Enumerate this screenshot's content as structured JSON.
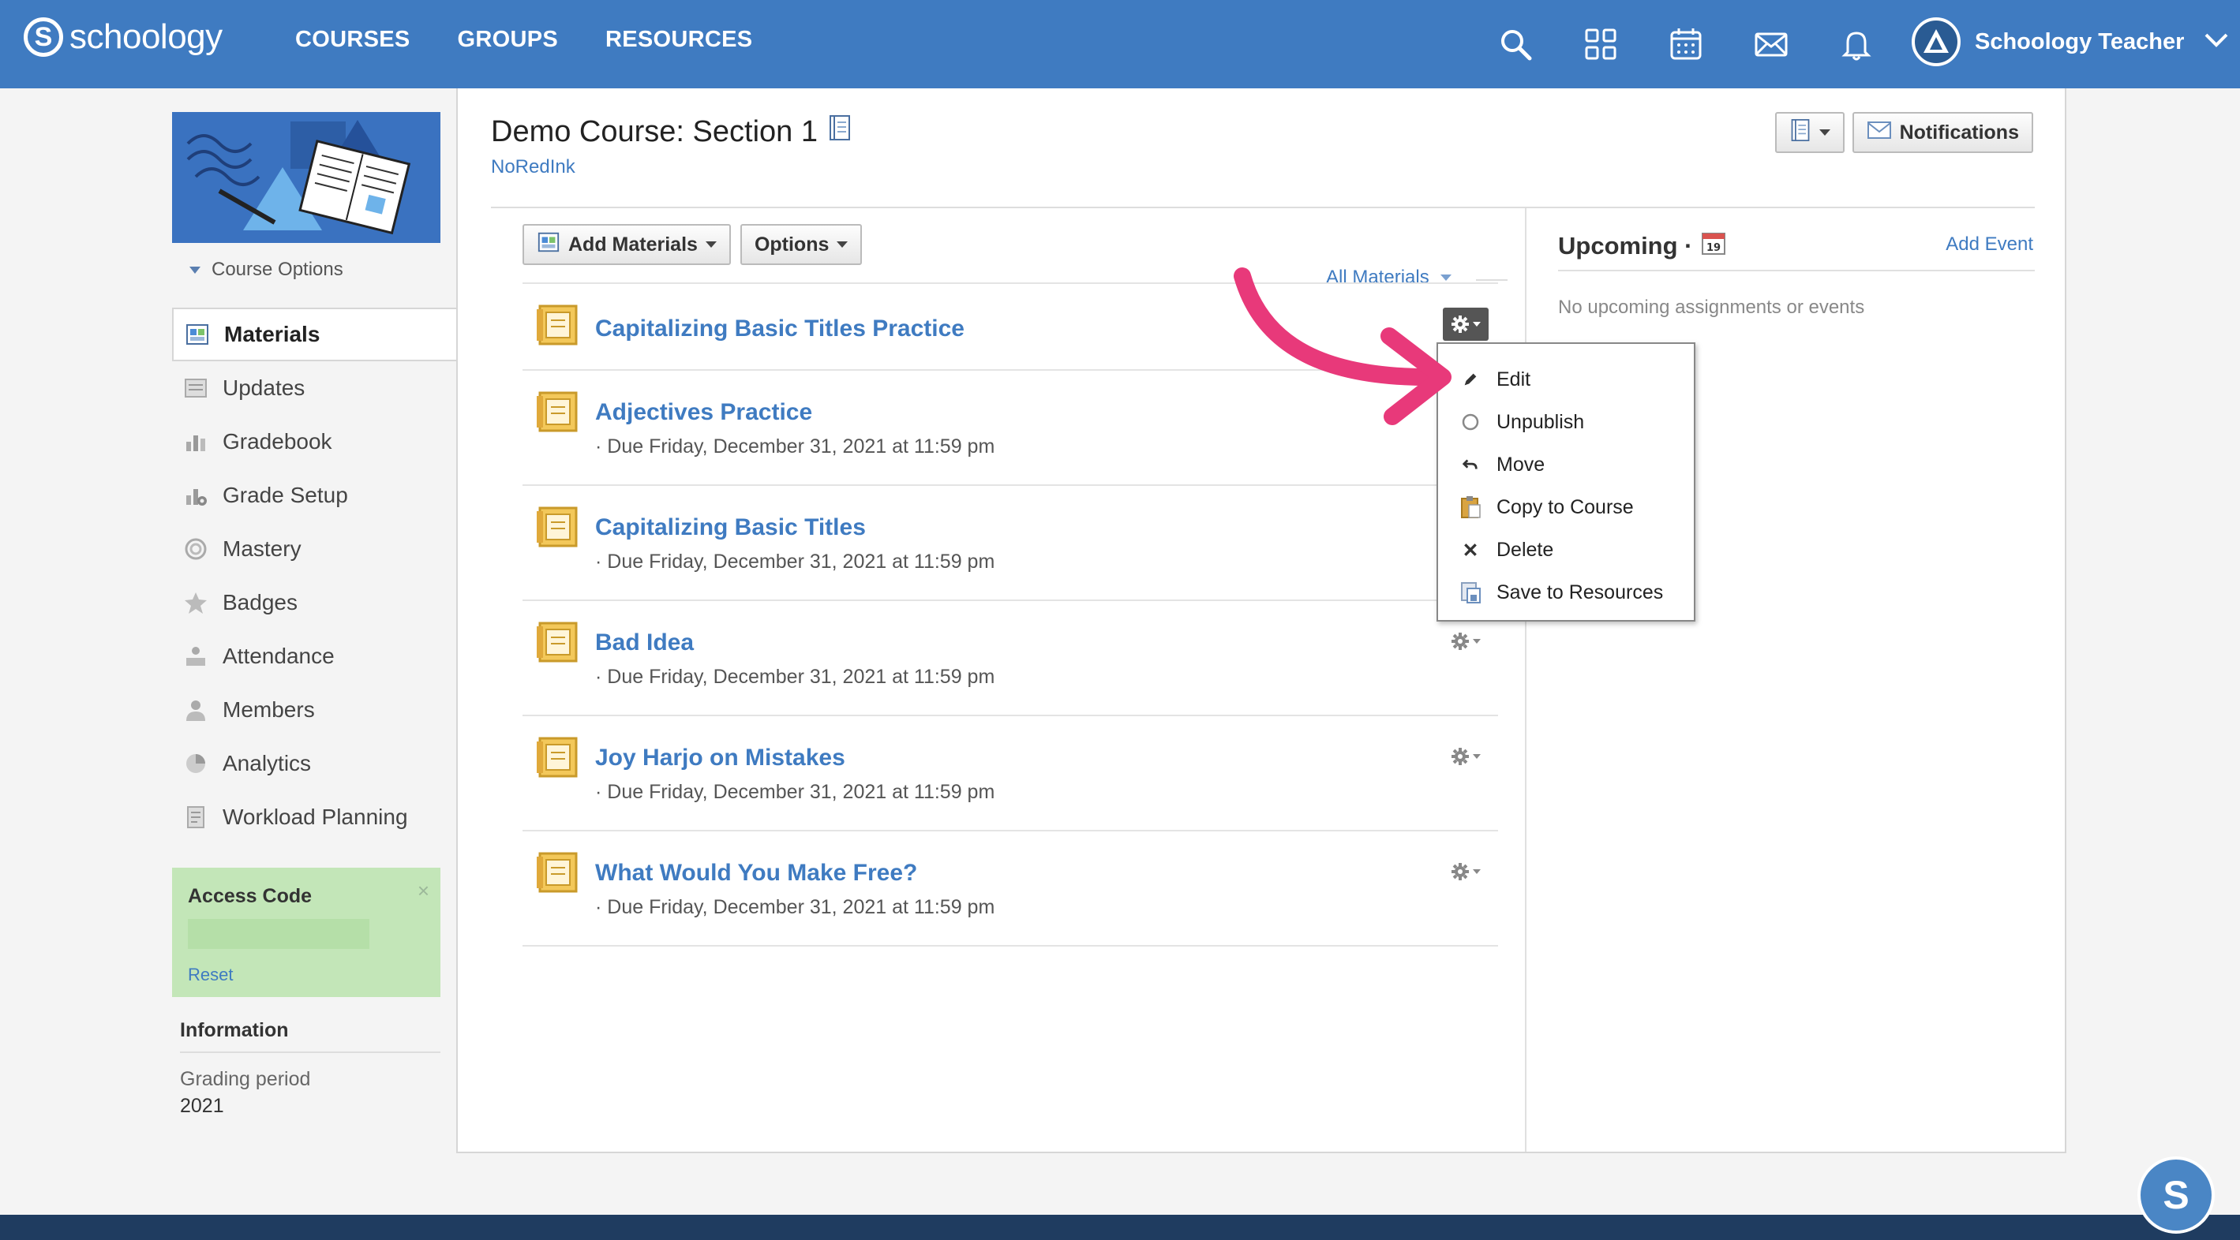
{
  "brand": {
    "name": "schoology",
    "logo_letter": "S"
  },
  "topnav": {
    "links": [
      "COURSES",
      "GROUPS",
      "RESOURCES"
    ],
    "icons": [
      "search-icon",
      "apps-grid-icon",
      "calendar-icon",
      "mail-icon",
      "bell-icon"
    ],
    "user_name": "Schoology Teacher"
  },
  "sidebar": {
    "course_options": "Course Options",
    "items": [
      {
        "label": "Materials",
        "icon": "materials-icon",
        "active": true
      },
      {
        "label": "Updates",
        "icon": "updates-icon"
      },
      {
        "label": "Gradebook",
        "icon": "gradebook-icon"
      },
      {
        "label": "Grade Setup",
        "icon": "grade-setup-icon"
      },
      {
        "label": "Mastery",
        "icon": "mastery-icon"
      },
      {
        "label": "Badges",
        "icon": "badges-icon"
      },
      {
        "label": "Attendance",
        "icon": "attendance-icon"
      },
      {
        "label": "Members",
        "icon": "members-icon"
      },
      {
        "label": "Analytics",
        "icon": "analytics-icon"
      },
      {
        "label": "Workload Planning",
        "icon": "workload-icon"
      }
    ],
    "access_code": {
      "title": "Access Code",
      "reset": "Reset",
      "close": "×"
    },
    "information": {
      "title": "Information",
      "grading_period_label": "Grading period",
      "grading_period_value": "2021"
    }
  },
  "course": {
    "title": "Demo Course: Section 1",
    "subtitle": "NoRedInk",
    "notifications_label": "Notifications"
  },
  "toolbar": {
    "add_materials": "Add Materials",
    "options": "Options",
    "filter": "All Materials"
  },
  "materials": [
    {
      "title": "Capitalizing Basic Titles Practice",
      "due": ""
    },
    {
      "title": "Adjectives Practice",
      "due": "· Due Friday, December 31, 2021 at 11:59 pm"
    },
    {
      "title": "Capitalizing Basic Titles",
      "due": "· Due Friday, December 31, 2021 at 11:59 pm"
    },
    {
      "title": "Bad Idea",
      "due": "· Due Friday, December 31, 2021 at 11:59 pm"
    },
    {
      "title": "Joy Harjo on Mistakes",
      "due": "· Due Friday, December 31, 2021 at 11:59 pm"
    },
    {
      "title": "What Would You Make Free?",
      "due": "· Due Friday, December 31, 2021 at 11:59 pm"
    }
  ],
  "action_menu": {
    "items": [
      {
        "label": "Edit",
        "icon": "pencil-icon"
      },
      {
        "label": "Unpublish",
        "icon": "circle-icon"
      },
      {
        "label": "Move",
        "icon": "move-arrow-icon"
      },
      {
        "label": "Copy to Course",
        "icon": "clipboard-icon"
      },
      {
        "label": "Delete",
        "icon": "x-icon"
      },
      {
        "label": "Save to Resources",
        "icon": "save-resources-icon"
      }
    ]
  },
  "upcoming": {
    "title": "Upcoming ·",
    "calendar_day": "19",
    "add_event": "Add Event",
    "empty": "No upcoming assignments or events"
  },
  "help_bubble": "S",
  "colors": {
    "nav_blue": "#3f7bc1",
    "link_blue": "#3f7bc1",
    "access_green": "#c3e6b8",
    "arrow_pink": "#e8397a",
    "footer_navy": "#1f3c60"
  }
}
